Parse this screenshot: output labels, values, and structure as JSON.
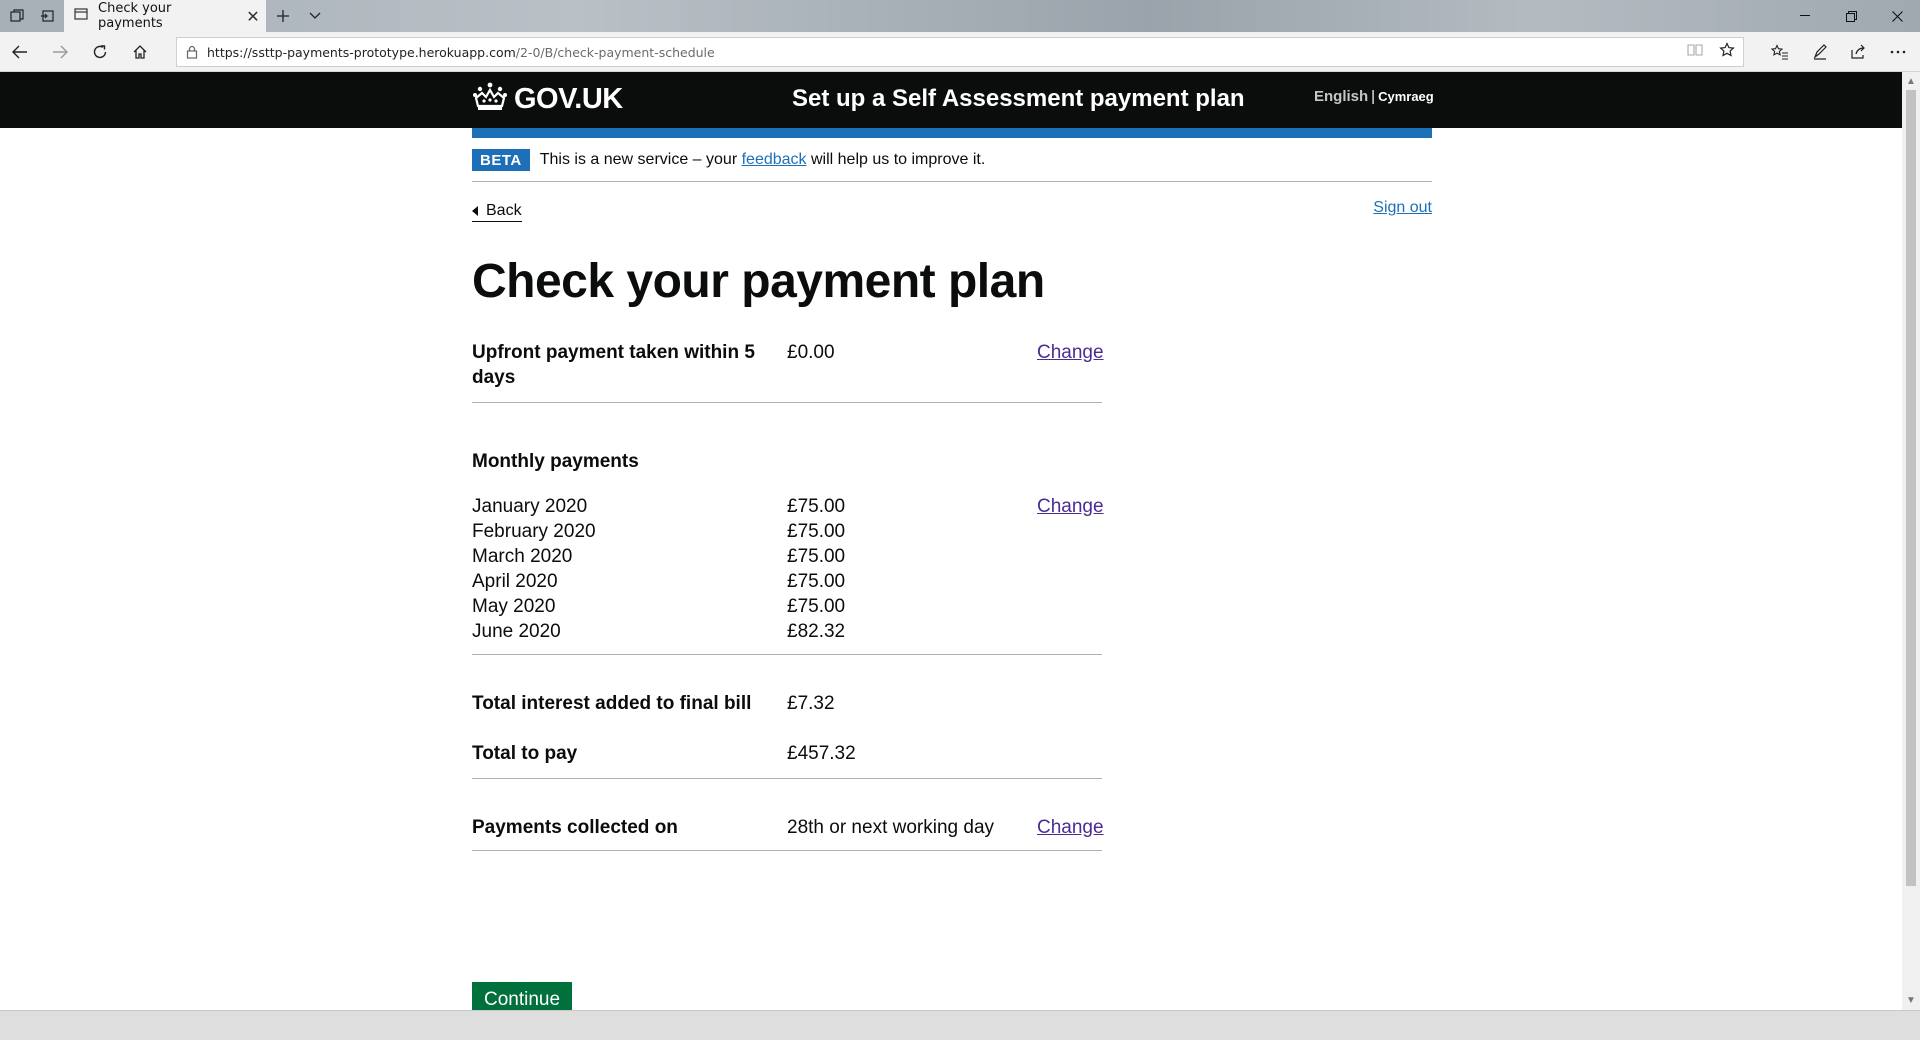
{
  "browser": {
    "tab_title": "Check your payments",
    "url_host": "https://ssttp-payments-prototype.herokuapp.com",
    "url_path": "/2-0/B/check-payment-schedule"
  },
  "header": {
    "logo_text": "GOV.UK",
    "service_name": "Set up a Self Assessment payment plan",
    "lang_english": "English",
    "lang_separator": "|",
    "lang_welsh": "Cymraeg"
  },
  "phase_banner": {
    "tag": "BETA",
    "text_before": "This is a new service – your",
    "link": "feedback",
    "text_after": "will help us to improve it."
  },
  "nav": {
    "back": "Back",
    "sign_out": "Sign out"
  },
  "page_title": "Check your payment plan",
  "summary": {
    "upfront_key": "Upfront payment taken within 5 days",
    "upfront_value": "£0.00",
    "change_label": "Change",
    "monthly_heading": "Monthly payments",
    "monthly": [
      {
        "month": "January 2020",
        "amount": "£75.00"
      },
      {
        "month": "February 2020",
        "amount": "£75.00"
      },
      {
        "month": "March 2020",
        "amount": "£75.00"
      },
      {
        "month": "April 2020",
        "amount": "£75.00"
      },
      {
        "month": "May 2020",
        "amount": "£75.00"
      },
      {
        "month": "June 2020",
        "amount": "£82.32"
      }
    ],
    "interest_key": "Total interest added to final bill",
    "interest_value": "£7.32",
    "total_key": "Total to pay",
    "total_value": "£457.32",
    "collected_key": "Payments collected on",
    "collected_value": "28th or next working day"
  },
  "continue_label": "Continue",
  "colors": {
    "header_bg": "#0b0c0c",
    "brand_blue": "#1d70b8",
    "button_green": "#00703c",
    "visited_link": "#4c2c92"
  }
}
